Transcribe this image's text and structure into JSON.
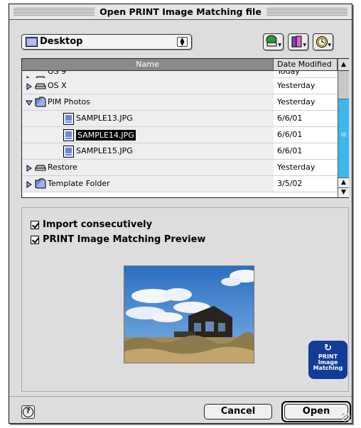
{
  "window": {
    "title": "Open PRINT Image Matching file"
  },
  "location": {
    "selected": "Desktop"
  },
  "toolbar": {
    "buttons": [
      {
        "name": "volume-shortcuts-icon"
      },
      {
        "name": "favorites-icon"
      },
      {
        "name": "recent-items-icon"
      }
    ]
  },
  "browser": {
    "columns": {
      "name": "Name",
      "date": "Date Modified"
    },
    "rows": [
      {
        "name": "OS 9",
        "date": "Today",
        "kind": "disk",
        "indent": 0,
        "expanded": false,
        "partial": true
      },
      {
        "name": "OS X",
        "date": "Yesterday",
        "kind": "disk",
        "indent": 0,
        "expanded": false
      },
      {
        "name": "PIM Photos",
        "date": "Yesterday",
        "kind": "folder",
        "indent": 0,
        "expanded": true
      },
      {
        "name": "SAMPLE13.JPG",
        "date": "6/6/01",
        "kind": "file",
        "indent": 1
      },
      {
        "name": "SAMPLE14.JPG",
        "date": "6/6/01",
        "kind": "file",
        "indent": 1,
        "selected": true
      },
      {
        "name": "SAMPLE15.JPG",
        "date": "6/6/01",
        "kind": "file",
        "indent": 1
      },
      {
        "name": "Restore",
        "date": "Yesterday",
        "kind": "disk",
        "indent": 0,
        "expanded": false
      },
      {
        "name": "Template Folder",
        "date": "3/5/02",
        "kind": "folder",
        "indent": 0,
        "expanded": false
      }
    ]
  },
  "options": {
    "import_consecutively": {
      "label": "Import consecutively",
      "checked": true
    },
    "pim_preview": {
      "label": "PRINT Image Matching Preview",
      "checked": true
    }
  },
  "logo": {
    "line1": "PRINT",
    "line2": "Image",
    "line3": "Matching"
  },
  "buttons": {
    "cancel": "Cancel",
    "open": "Open",
    "help": "?"
  },
  "colors": {
    "scroll_accent": "#3cb8ee",
    "logo_bg": "#123c97",
    "selection": "#000000"
  }
}
